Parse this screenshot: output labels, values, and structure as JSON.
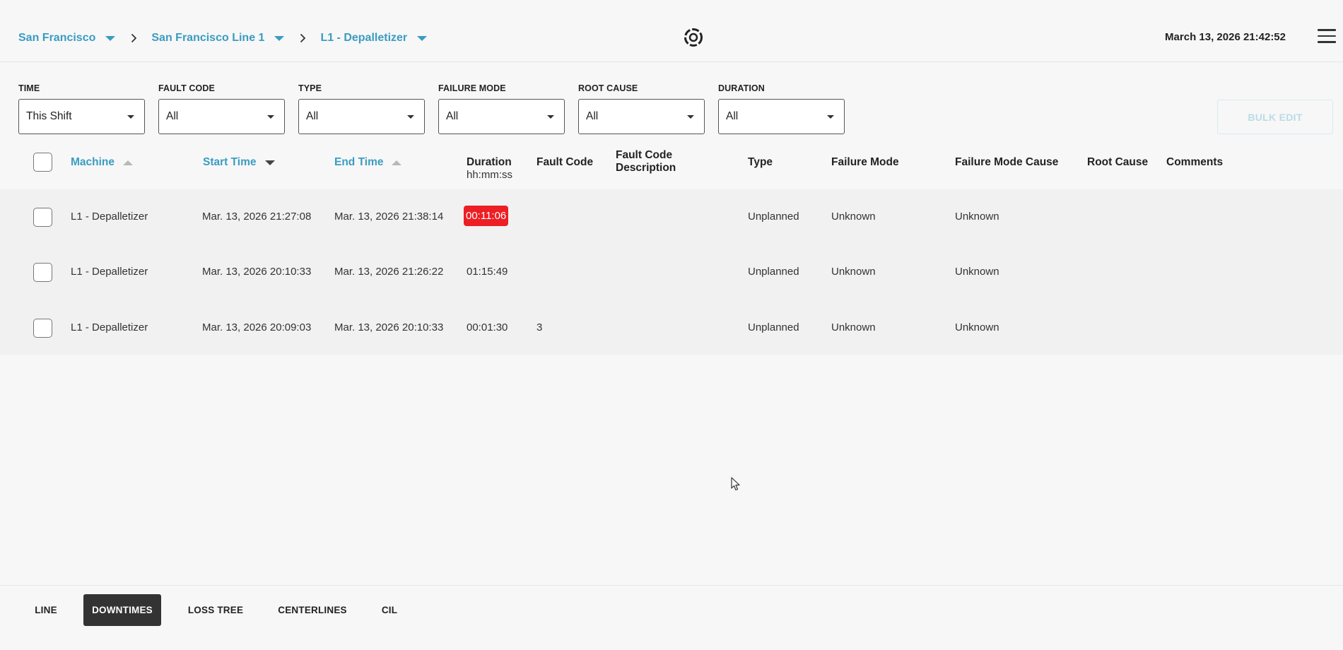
{
  "breadcrumbs": [
    {
      "label": "San Francisco"
    },
    {
      "label": "San Francisco Line 1"
    },
    {
      "label": "L1 - Depalletizer"
    }
  ],
  "header": {
    "datetime": "March 13, 2026 21:42:52"
  },
  "filters": [
    {
      "label": "TIME",
      "value": "This Shift"
    },
    {
      "label": "FAULT CODE",
      "value": "All"
    },
    {
      "label": "TYPE",
      "value": "All"
    },
    {
      "label": "FAILURE MODE",
      "value": "All"
    },
    {
      "label": "ROOT CAUSE",
      "value": "All"
    },
    {
      "label": "DURATION",
      "value": "All"
    }
  ],
  "bulk_edit_label": "BULK EDIT",
  "table": {
    "headers": {
      "machine": "Machine",
      "start_time": "Start Time",
      "end_time": "End Time",
      "duration": "Duration",
      "duration_unit": "hh:mm:ss",
      "fault_code": "Fault Code",
      "fault_code_desc_1": "Fault Code",
      "fault_code_desc_2": "Description",
      "type": "Type",
      "failure_mode": "Failure Mode",
      "failure_mode_cause": "Failure Mode Cause",
      "root_cause": "Root Cause",
      "comments": "Comments"
    },
    "rows": [
      {
        "machine": "L1 - Depalletizer",
        "start": "Mar. 13, 2026 21:27:08",
        "end": "Mar. 13, 2026 21:38:14",
        "duration": "00:11:06",
        "fault_code": "",
        "fault_desc": "",
        "type": "Unplanned",
        "failure_mode": "Unknown",
        "failure_mode_cause": "Unknown",
        "root_cause": "",
        "comments": "",
        "highlight": true
      },
      {
        "machine": "L1 - Depalletizer",
        "start": "Mar. 13, 2026 20:10:33",
        "end": "Mar. 13, 2026 21:26:22",
        "duration": "01:15:49",
        "fault_code": "",
        "fault_desc": "",
        "type": "Unplanned",
        "failure_mode": "Unknown",
        "failure_mode_cause": "Unknown",
        "root_cause": "",
        "comments": ""
      },
      {
        "machine": "L1 - Depalletizer",
        "start": "Mar. 13, 2026 20:09:03",
        "end": "Mar. 13, 2026 20:10:33",
        "duration": "00:01:30",
        "fault_code": "3",
        "fault_desc": "",
        "type": "Unplanned",
        "failure_mode": "Unknown",
        "failure_mode_cause": "Unknown",
        "root_cause": "",
        "comments": ""
      }
    ]
  },
  "nav_tabs": [
    {
      "label": "LINE"
    },
    {
      "label": "DOWNTIMES",
      "active": true
    },
    {
      "label": "LOSS TREE"
    },
    {
      "label": "CENTERLINES"
    },
    {
      "label": "CIL"
    }
  ],
  "colors": {
    "accent": "#3a9cc1",
    "highlight_red": "#ec1f25",
    "active_tab": "#333333",
    "background": "#f7f7f7"
  },
  "icons": [
    "chevron-down-icon",
    "chevron-right-icon",
    "logo-icon",
    "hamburger-menu-icon",
    "sort-asc-icon",
    "sort-desc-icon",
    "mouse-cursor-icon"
  ]
}
